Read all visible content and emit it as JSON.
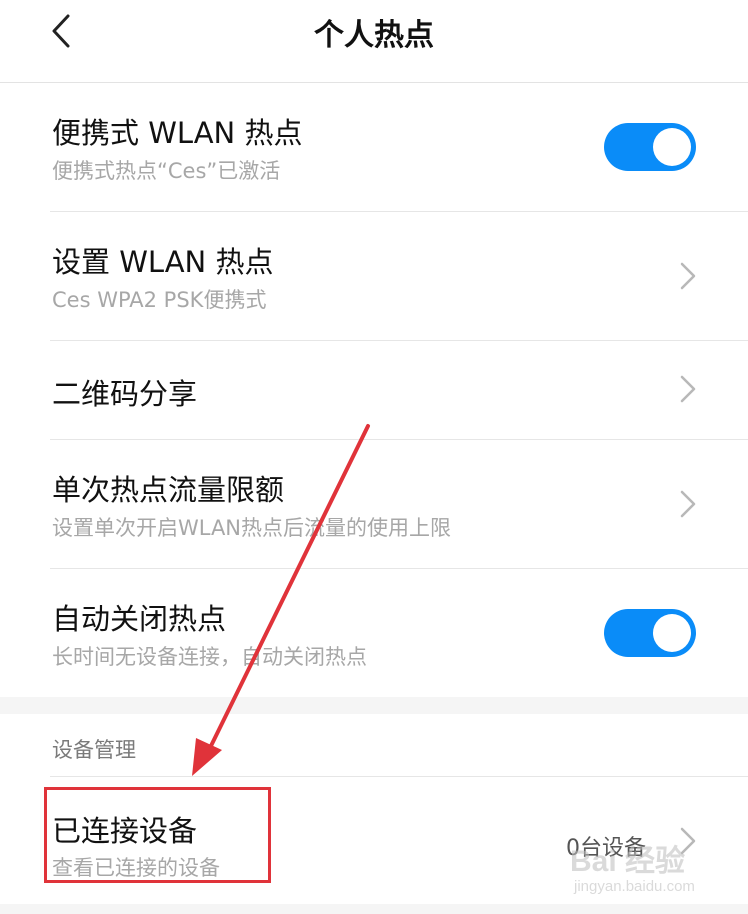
{
  "header": {
    "title": "个人热点"
  },
  "settings": [
    {
      "title": "便携式 WLAN 热点",
      "subtitle": "便携式热点“Ces”已激活",
      "control": "toggle",
      "on": true
    },
    {
      "title": "设置 WLAN 热点",
      "subtitle": "Ces WPA2 PSK便携式",
      "control": "chevron"
    },
    {
      "title": "二维码分享",
      "subtitle": "",
      "control": "chevron"
    },
    {
      "title": "单次热点流量限额",
      "subtitle": "设置单次开启WLAN热点后流量的使用上限",
      "control": "chevron"
    },
    {
      "title": "自动关闭热点",
      "subtitle": "长时间无设备连接，自动关闭热点",
      "control": "toggle",
      "on": true
    }
  ],
  "device_section": {
    "label": "设备管理",
    "connected": {
      "title": "已连接设备",
      "subtitle": "查看已连接的设备",
      "value": "0台设备"
    }
  },
  "icons": {
    "back": "chevron-left-icon",
    "row_arrow": "chevron-right-icon"
  },
  "colors": {
    "toggle_on": "#0a8cf8",
    "annotation": "#e0333a"
  },
  "watermark": {
    "main": "Bai 经验",
    "sub": "jingyan.baidu.com"
  }
}
